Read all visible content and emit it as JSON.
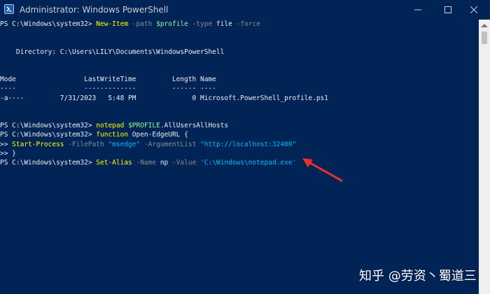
{
  "window": {
    "title": "Administrator: Windows PowerShell",
    "icon": "powershell-icon",
    "controls": [
      "minimize-icon",
      "maximize-icon",
      "close-icon"
    ]
  },
  "colors": {
    "background": "#012456",
    "text": "#eeedf0",
    "command": "#ffff00",
    "variable": "#98fb98",
    "parameter": "#8a8a8a",
    "string": "#00bfff",
    "arrow": "#e8322a"
  },
  "console": {
    "lines": [
      [
        {
          "t": "PS C:\\Windows\\system32> ",
          "c": "text"
        },
        {
          "t": "New-Item",
          "c": "command"
        },
        {
          "t": " -path ",
          "c": "parameter"
        },
        {
          "t": "$profile",
          "c": "variable"
        },
        {
          "t": " -type ",
          "c": "parameter"
        },
        {
          "t": "file",
          "c": "text"
        },
        {
          "t": " -force",
          "c": "parameter"
        }
      ],
      [],
      [],
      [
        {
          "t": "    Directory: C:\\Users\\LILY\\Documents\\WindowsPowerShell",
          "c": "text"
        }
      ],
      [],
      [],
      [
        {
          "t": "Mode                 LastWriteTime         Length Name",
          "c": "text"
        }
      ],
      [
        {
          "t": "----                 -------------         ------ ----",
          "c": "text"
        }
      ],
      [
        {
          "t": "-a----         7/31/2023   5:48 PM              0 Microsoft.PowerShell_profile.ps1",
          "c": "text"
        }
      ],
      [],
      [],
      [
        {
          "t": "PS C:\\Windows\\system32> ",
          "c": "text"
        },
        {
          "t": "notepad",
          "c": "command"
        },
        {
          "t": " ",
          "c": "text"
        },
        {
          "t": "$PROFILE",
          "c": "variable"
        },
        {
          "t": ".AllUsersAllHosts",
          "c": "text"
        }
      ],
      [
        {
          "t": "PS C:\\Windows\\system32> ",
          "c": "text"
        },
        {
          "t": "function",
          "c": "command"
        },
        {
          "t": " Open-EdgeURL {",
          "c": "text"
        }
      ],
      [
        {
          "t": ">> ",
          "c": "text"
        },
        {
          "t": "Start-Process",
          "c": "command"
        },
        {
          "t": " -FilePath ",
          "c": "parameter"
        },
        {
          "t": "\"msedge\"",
          "c": "string"
        },
        {
          "t": " -ArgumentList ",
          "c": "parameter"
        },
        {
          "t": "\"http://localhost:32400\"",
          "c": "string"
        }
      ],
      [
        {
          "t": ">> }",
          "c": "text"
        }
      ],
      [
        {
          "t": "PS C:\\Windows\\system32> ",
          "c": "text"
        },
        {
          "t": "Set-Alias",
          "c": "command"
        },
        {
          "t": " -Name ",
          "c": "parameter"
        },
        {
          "t": "np",
          "c": "text"
        },
        {
          "t": " -Value ",
          "c": "parameter"
        },
        {
          "t": "'C:\\Windows\\notepad.exe'",
          "c": "string"
        }
      ]
    ]
  },
  "watermark": "知乎 @劳资丶蜀道三"
}
